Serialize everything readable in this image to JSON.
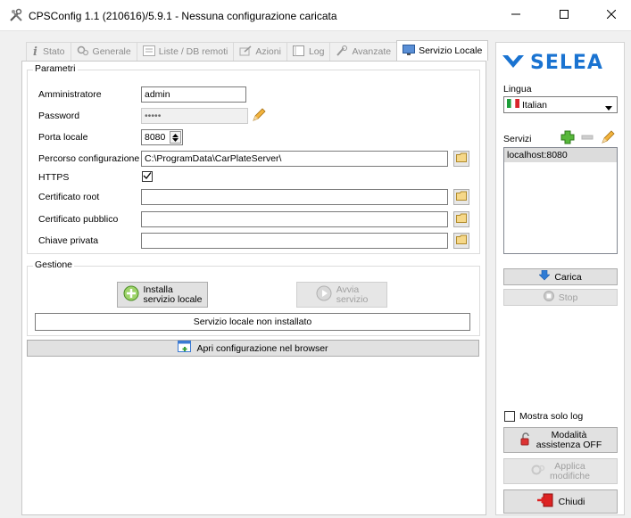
{
  "window": {
    "title": "CPSConfig 1.1 (210616)/5.9.1 - Nessuna configurazione caricata"
  },
  "tabs": [
    {
      "label": "Stato",
      "icon": "info-icon"
    },
    {
      "label": "Generale",
      "icon": "gears-icon"
    },
    {
      "label": "Liste / DB remoti",
      "icon": "list-icon"
    },
    {
      "label": "Azioni",
      "icon": "actions-icon"
    },
    {
      "label": "Log",
      "icon": "log-icon"
    },
    {
      "label": "Avanzate",
      "icon": "advanced-icon"
    },
    {
      "label": "Servizio Locale",
      "icon": "monitor-icon",
      "active": true
    }
  ],
  "parametri": {
    "title": "Parametri",
    "admin_label": "Amministratore",
    "admin_value": "admin",
    "password_label": "Password",
    "password_value": "•••••",
    "port_label": "Porta locale",
    "port_value": "8080",
    "dbpath_label": "Percorso configurazione DB",
    "dbpath_value": "C:\\ProgramData\\CarPlateServer\\",
    "https_label": "HTTPS",
    "https_checked": true,
    "cert_root_label": "Certificato root",
    "cert_root_value": "",
    "cert_pub_label": "Certificato pubblico",
    "cert_pub_value": "",
    "key_label": "Chiave privata",
    "key_value": ""
  },
  "gestione": {
    "title": "Gestione",
    "install_line1": "Installa",
    "install_line2": "servizio locale",
    "start_line1": "Avvia",
    "start_line2": "servizio",
    "status": "Servizio locale non installato"
  },
  "open_browser_label": "Apri configurazione nel browser",
  "right": {
    "brand": "SELEA",
    "brand_color": "#1a73d1",
    "lingua_label": "Lingua",
    "language_value": "Italian",
    "servizi_label": "Servizi",
    "services": [
      "localhost:8080"
    ],
    "carica_label": "Carica",
    "stop_label": "Stop",
    "only_log_label": "Mostra solo log",
    "only_log_checked": false,
    "assist_line1": "Modalità",
    "assist_line2": "assistenza OFF",
    "apply_line1": "Applica",
    "apply_line2": "modifiche",
    "close_label": "Chiudi"
  }
}
